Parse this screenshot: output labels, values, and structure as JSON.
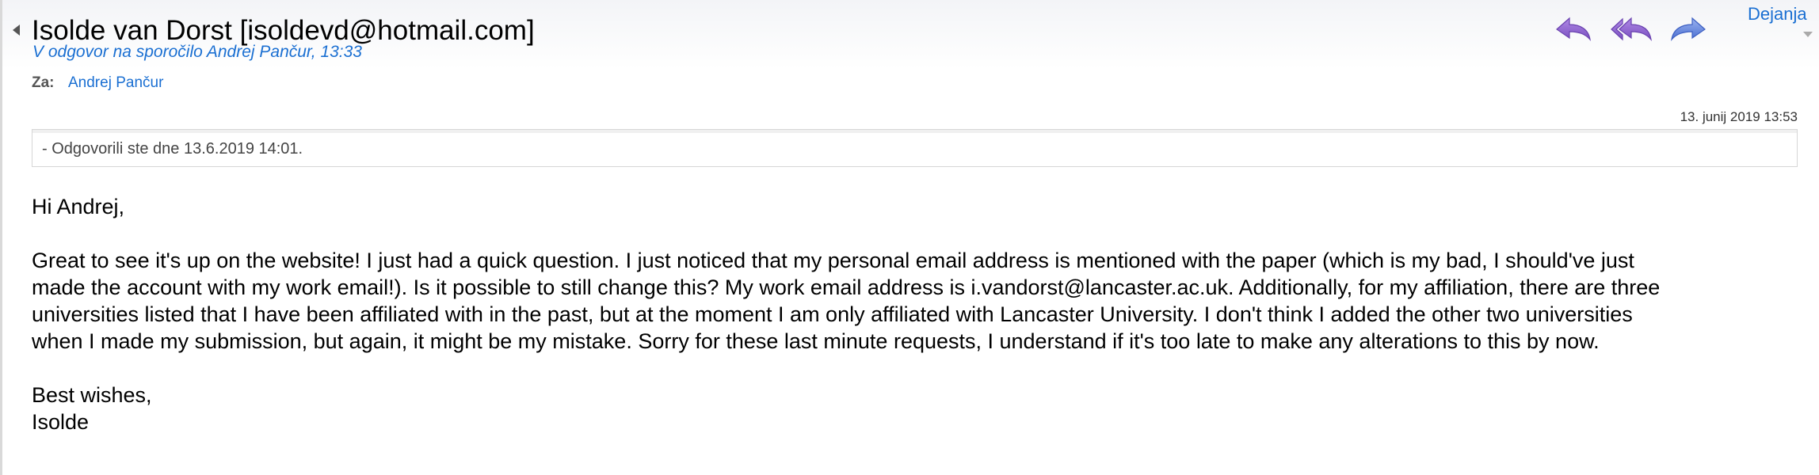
{
  "header": {
    "sender": "Isolde van Dorst [isoldevd@hotmail.com]",
    "reply_info": "V odgovor na sporočilo Andrej Pančur, 13:33",
    "to_label": "Za:",
    "to_value": "Andrej Pančur"
  },
  "actions": {
    "menu_label": "Dejanja",
    "icons": [
      "reply-icon",
      "reply-all-icon",
      "forward-icon"
    ],
    "icon_color": "#8c63c9"
  },
  "message": {
    "date": "13. junij 2019 13:53",
    "replied_notice": "Odgovorili ste dne 13.6.2019 14:01.",
    "greeting": "Hi Andrej,",
    "body_lines": [
      "Great to see it's up on the website! I just had a quick question. I just noticed that my personal email address is mentioned with the paper (which is my bad, I should've just",
      "made the account with my work email!). Is it possible to still change this? My work email address is i.vandorst@lancaster.ac.uk. Additionally, for my affiliation, there are three",
      "universities listed that I have been affiliated with in the past, but at the moment I am only affiliated with Lancaster University. I don't think I added the other two universities",
      "when I made my submission, but again, it might be my mistake. Sorry for these last minute requests, I understand if it's too late to make any alterations to this by now."
    ],
    "closing": "Best wishes,",
    "signature": "Isolde"
  },
  "colors": {
    "link": "#1a6fd2",
    "header_bg": "#f3f4f7"
  }
}
